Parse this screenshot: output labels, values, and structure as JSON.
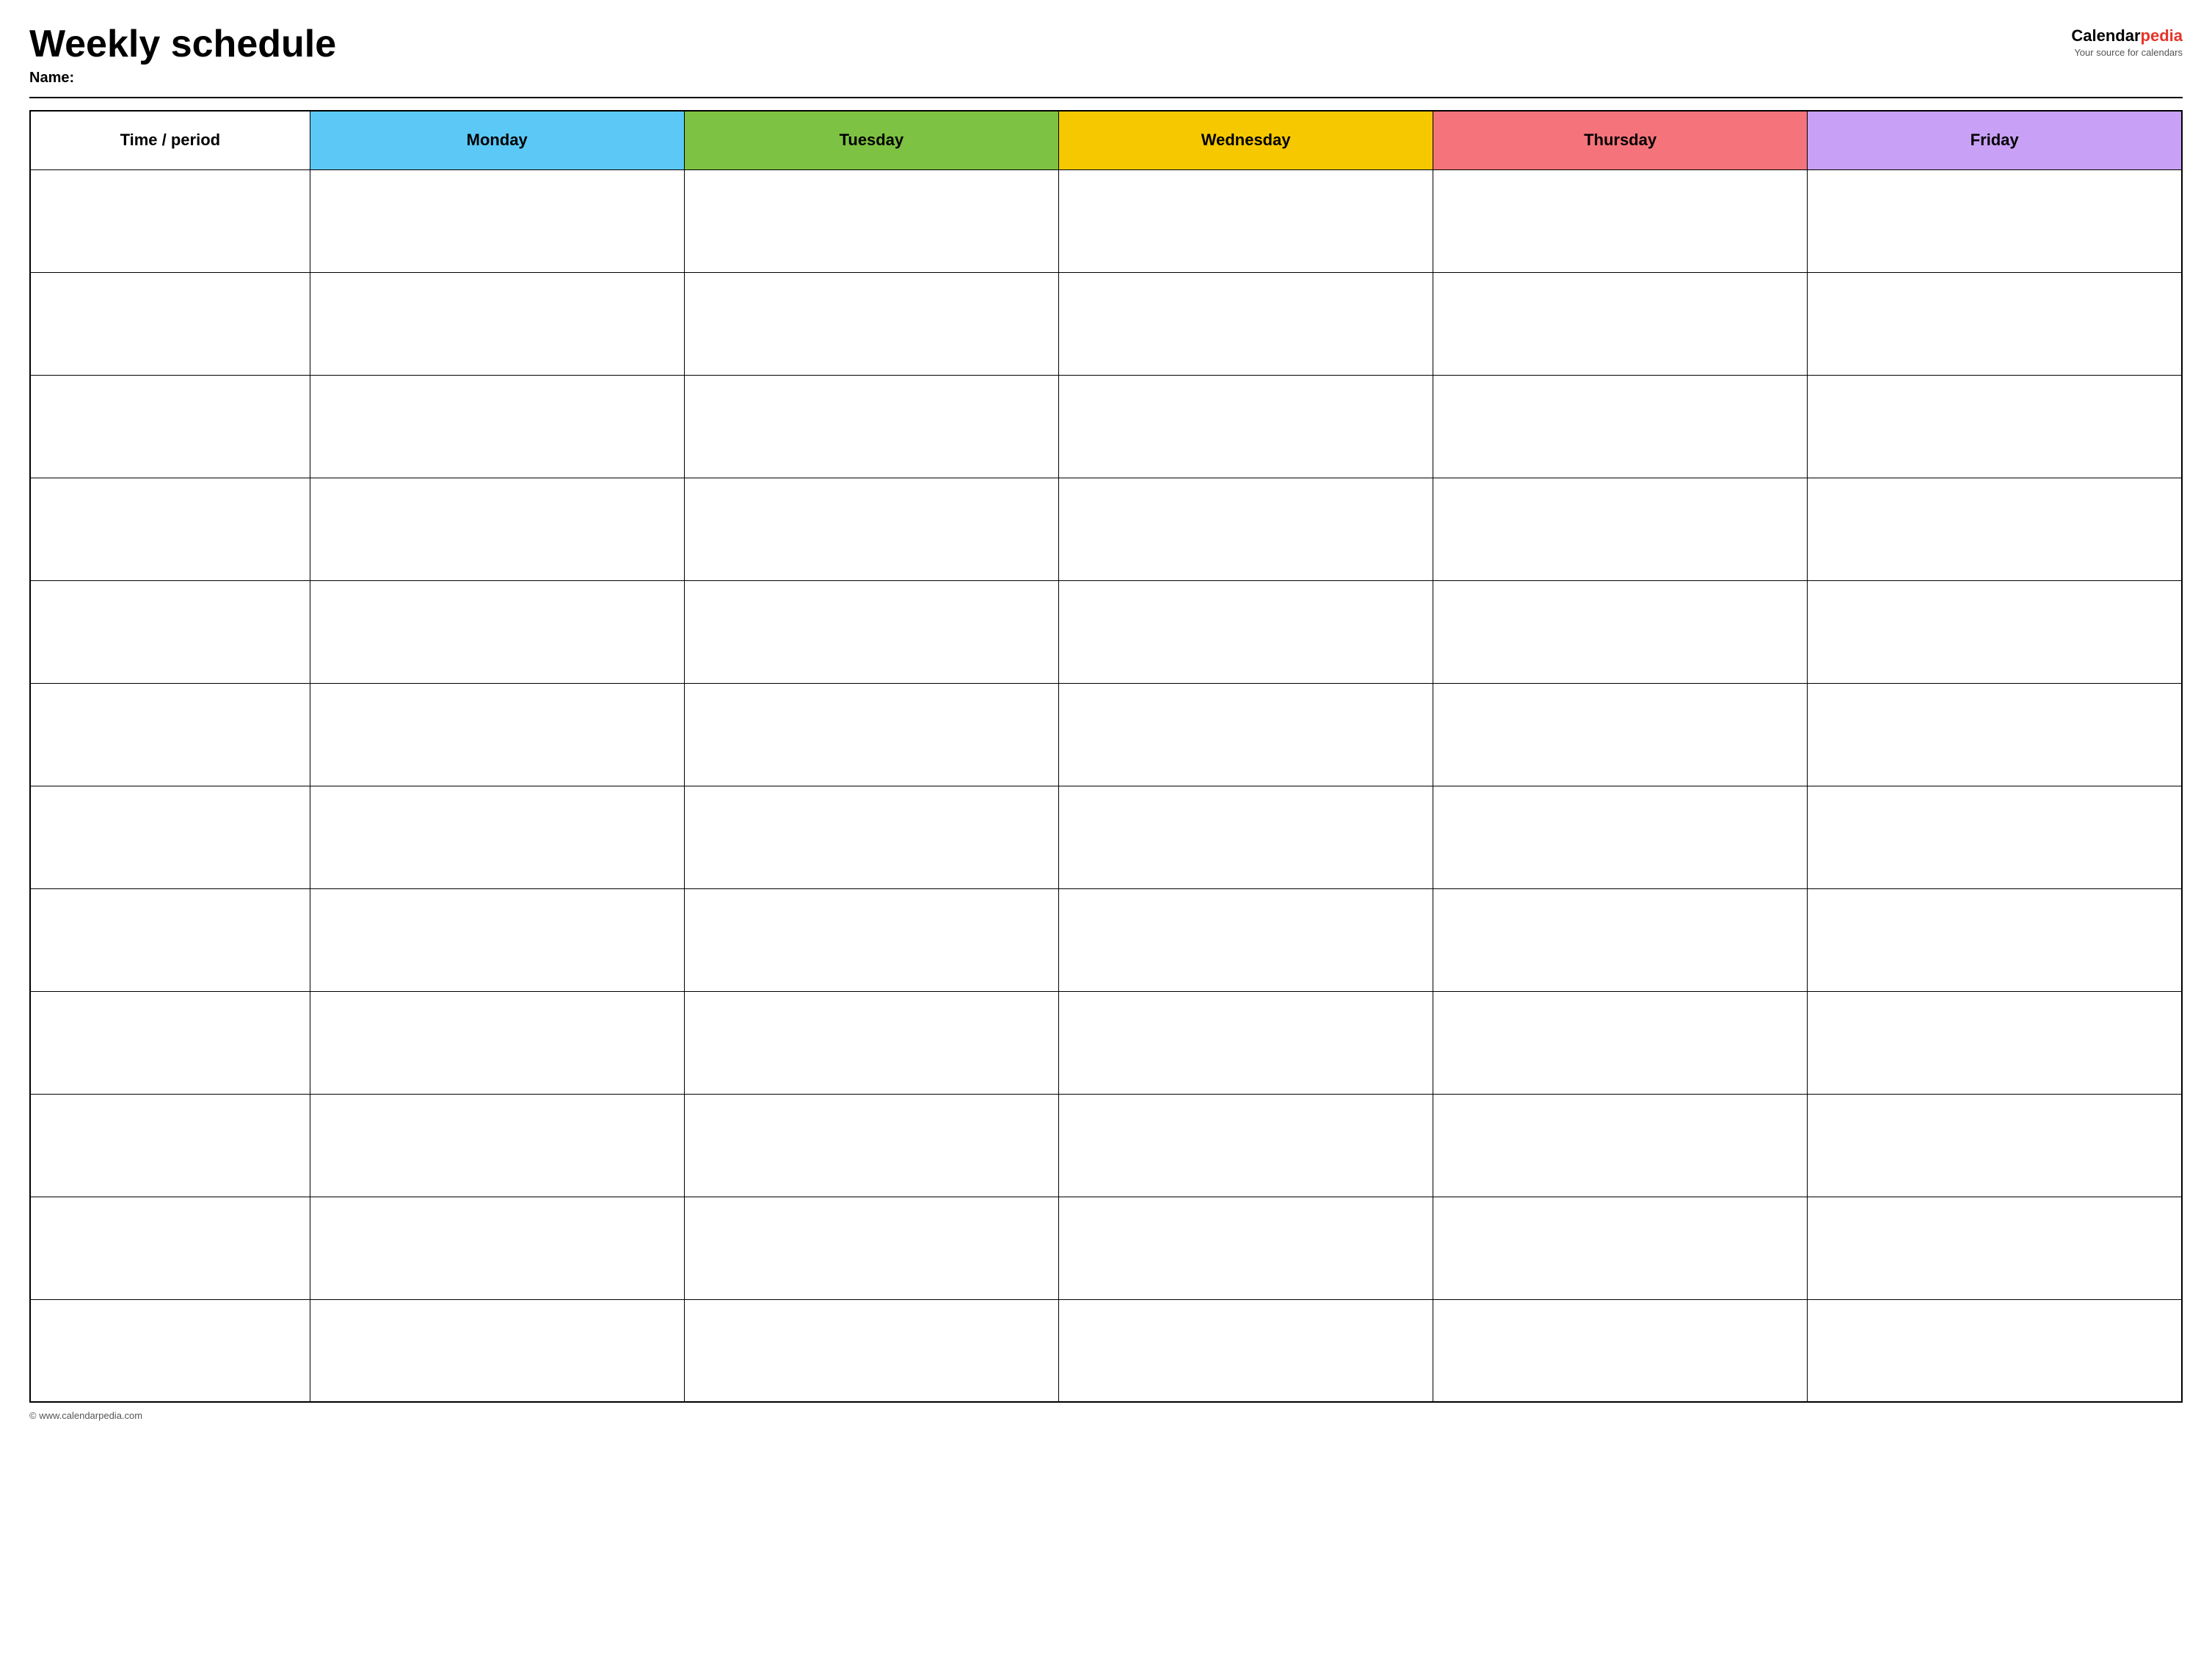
{
  "header": {
    "title": "Weekly schedule",
    "name_label": "Name:",
    "logo_text_black": "Calendar",
    "logo_text_red": "pedia",
    "logo_tagline": "Your source for calendars"
  },
  "table": {
    "columns": [
      {
        "id": "time",
        "label": "Time / period",
        "color": "#ffffff",
        "class": "th-time"
      },
      {
        "id": "monday",
        "label": "Monday",
        "color": "#5bc8f5",
        "class": "th-monday"
      },
      {
        "id": "tuesday",
        "label": "Tuesday",
        "color": "#7dc242",
        "class": "th-tuesday"
      },
      {
        "id": "wednesday",
        "label": "Wednesday",
        "color": "#f5c800",
        "class": "th-wednesday"
      },
      {
        "id": "thursday",
        "label": "Thursday",
        "color": "#f5737a",
        "class": "th-thursday"
      },
      {
        "id": "friday",
        "label": "Friday",
        "color": "#c8a0f5",
        "class": "th-friday"
      }
    ],
    "row_count": 12
  },
  "footer": {
    "text": "© www.calendarpedia.com"
  }
}
